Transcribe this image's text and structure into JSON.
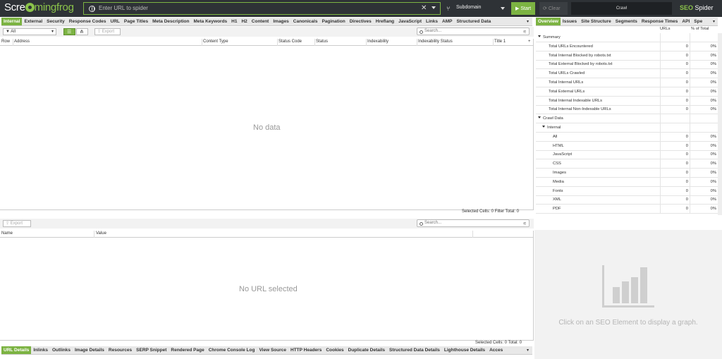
{
  "header": {
    "logo_left": "Scre",
    "logo_right": "mingfrog",
    "url_placeholder": "Enter URL to spider",
    "mode": "Subdomain",
    "start": "Start",
    "clear": "Clear",
    "crawl": "Crawl",
    "brand_seo": "SEO",
    "brand_spider": " Spider"
  },
  "top_tabs": [
    "Internal",
    "External",
    "Security",
    "Response Codes",
    "URL",
    "Page Titles",
    "Meta Description",
    "Meta Keywords",
    "H1",
    "H2",
    "Content",
    "Images",
    "Canonicals",
    "Pagination",
    "Directives",
    "Hreflang",
    "JavaScript",
    "Links",
    "AMP",
    "Structured Data"
  ],
  "filter": {
    "value": "All",
    "export": "Export",
    "search_placeholder": "Search..."
  },
  "main_columns": [
    "Row",
    "Address",
    "Content Type",
    "Status Code",
    "Status",
    "Indexability",
    "Indexability Status",
    "Title 1"
  ],
  "main_empty": "No data",
  "main_status": "Selected Cells:  0  Filter Total:  0",
  "detail": {
    "export": "Export",
    "search_placeholder": "Search...",
    "columns": [
      "Name",
      "Value"
    ],
    "empty": "No URL selected",
    "status": "Selected Cells:  0  Total:  0"
  },
  "bottom_tabs": [
    "URL Details",
    "Inlinks",
    "Outlinks",
    "Image Details",
    "Resources",
    "SERP Snippet",
    "Rendered Page",
    "Chrome Console Log",
    "View Source",
    "HTTP Headers",
    "Cookies",
    "Duplicate Details",
    "Structured Data Details",
    "Lighthouse Details",
    "Acces"
  ],
  "right_tabs": [
    "Overview",
    "Issues",
    "Site Structure",
    "Segments",
    "Response Times",
    "API",
    "Spe"
  ],
  "right_columns": [
    "URLs",
    "% of Total"
  ],
  "overview": {
    "summary_label": "Summary",
    "summary_rows": [
      {
        "label": "Total URLs Encountered",
        "count": "0",
        "pct": "0%"
      },
      {
        "label": "Total Internal Blocked by robots.txt",
        "count": "0",
        "pct": "0%"
      },
      {
        "label": "Total External Blocked by robots.txt",
        "count": "0",
        "pct": "0%"
      },
      {
        "label": "Total URLs Crawled",
        "count": "0",
        "pct": "0%"
      },
      {
        "label": "Total Internal URLs",
        "count": "0",
        "pct": "0%"
      },
      {
        "label": "Total External URLs",
        "count": "0",
        "pct": "0%"
      },
      {
        "label": "Total Internal Indexable URLs",
        "count": "0",
        "pct": "0%"
      },
      {
        "label": "Total Internal Non-Indexable URLs",
        "count": "0",
        "pct": "0%"
      }
    ],
    "crawl_label": "Crawl Data",
    "internal_label": "Internal",
    "internal_rows": [
      {
        "label": "All",
        "count": "0",
        "pct": "0%"
      },
      {
        "label": "HTML",
        "count": "0",
        "pct": "0%"
      },
      {
        "label": "JavaScript",
        "count": "0",
        "pct": "0%"
      },
      {
        "label": "CSS",
        "count": "0",
        "pct": "0%"
      },
      {
        "label": "Images",
        "count": "0",
        "pct": "0%"
      },
      {
        "label": "Media",
        "count": "0",
        "pct": "0%"
      },
      {
        "label": "Fonts",
        "count": "0",
        "pct": "0%"
      },
      {
        "label": "XML",
        "count": "0",
        "pct": "0%"
      },
      {
        "label": "PDF",
        "count": "0",
        "pct": "0%"
      }
    ]
  },
  "graph_message": "Click on an SEO Element to display a graph.",
  "colors": {
    "accent": "#7cb342",
    "topbar": "#2e3236"
  }
}
